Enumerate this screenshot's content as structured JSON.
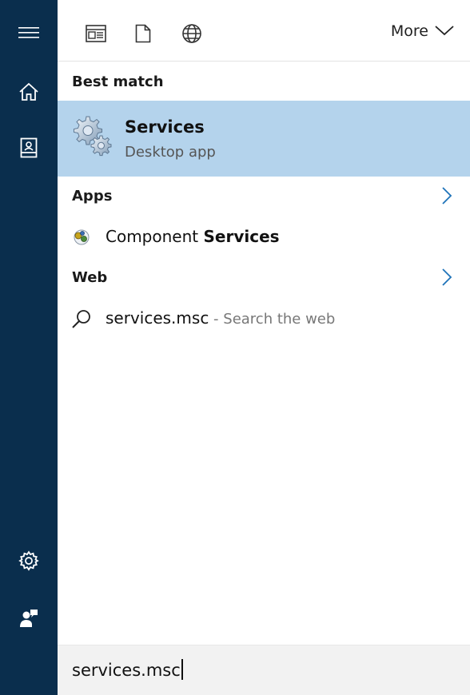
{
  "rail": {
    "items": [
      {
        "name": "hamburger-menu-icon"
      },
      {
        "name": "home-icon"
      },
      {
        "name": "notebook-icon"
      },
      {
        "name": "settings-gear-icon"
      },
      {
        "name": "feedback-icon"
      }
    ]
  },
  "toolbar": {
    "filters": [
      {
        "name": "apps-filter-icon"
      },
      {
        "name": "documents-filter-icon"
      },
      {
        "name": "web-filter-icon"
      }
    ],
    "more_label": "More"
  },
  "best_match": {
    "header": "Best match",
    "title": "Services",
    "subtitle": "Desktop app"
  },
  "apps": {
    "header": "Apps",
    "items": [
      {
        "prefix": "Component ",
        "bold": "Services"
      }
    ]
  },
  "web": {
    "header": "Web",
    "items": [
      {
        "query": "services.msc",
        "suffix": " - Search the web"
      }
    ]
  },
  "search": {
    "value": "services.msc"
  },
  "colors": {
    "rail": "#0a2e4d",
    "highlight": "#b4d3ec",
    "accent": "#1e73b9"
  }
}
